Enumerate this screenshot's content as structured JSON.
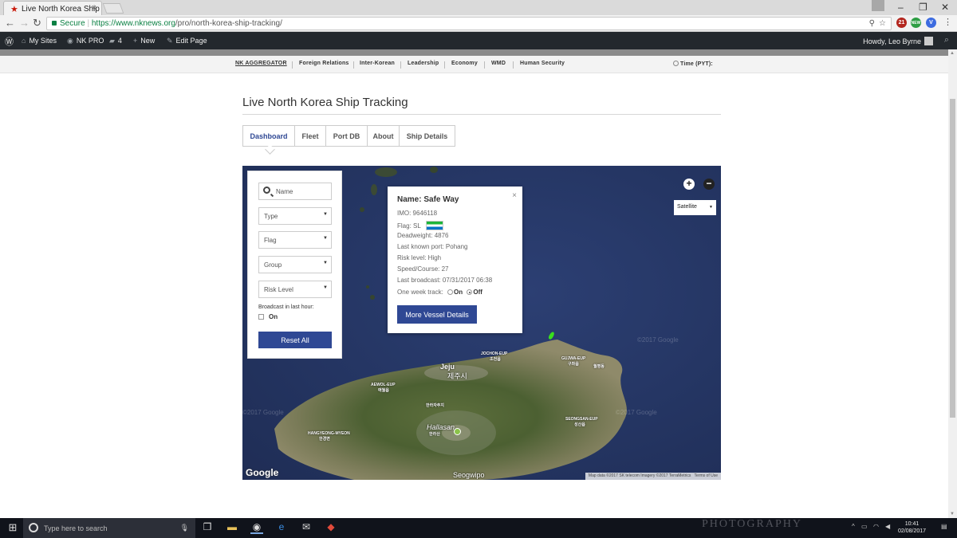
{
  "browser": {
    "tab_title": "Live North Korea Ship Tracking",
    "tab_close": "×",
    "secure_label": "Secure",
    "url_host": "https://www.nknews.org",
    "url_path": "/pro/north-korea-ship-tracking/",
    "ext_badge_new": "NEW",
    "ext_badge_count": "21"
  },
  "adminbar": {
    "my_sites": "My Sites",
    "nk_pro": "NK PRO",
    "comments_count": "4",
    "new": "New",
    "edit_page": "Edit Page",
    "greeting": "Howdy, Leo Byrne"
  },
  "sitenav": {
    "items": [
      "NK AGGREGATOR",
      "Foreign Relations",
      "Inter-Korean",
      "Leadership",
      "Economy",
      "WMD",
      "Human Security"
    ],
    "time_label": "Time (PYT):"
  },
  "page": {
    "title": "Live North Korea Ship Tracking",
    "tabs": [
      "Dashboard",
      "Fleet",
      "Port DB",
      "About",
      "Ship Details"
    ]
  },
  "filters": {
    "name_placeholder": "Name",
    "type": "Type",
    "flag": "Flag",
    "group": "Group",
    "risk_level": "Risk Level",
    "broadcast_label": "Broadcast in last hour:",
    "broadcast_on": "On",
    "reset": "Reset All"
  },
  "vessel_popup": {
    "name": "Name: Safe Way",
    "imo": "IMO: 9646118",
    "flag": "Flag: SL",
    "deadweight": "Deadweight: 4876",
    "last_port": "Last known port: Pohang",
    "risk": "Risk level: High",
    "speed": "Speed/Course: 27",
    "last_broadcast": "Last broadcast: 07/31/2017 06:38",
    "track_label": "One week track:",
    "track_on": "On",
    "track_off": "Off",
    "button": "More Vessel Details",
    "close": "×"
  },
  "map": {
    "map_type": "Satellite",
    "zoom_in": "+",
    "zoom_out": "−",
    "google": "Google",
    "attribution": "Map data ©2017 SK telecom Imagery ©2017 TerraMetrics",
    "terms": "Terms of Use",
    "watermark": "©2017 Google",
    "labels": {
      "jeju_en": "Jeju",
      "jeju_ko": "제주시",
      "jocheon": "JOCHON-EUP",
      "jocheon_ko": "조천읍",
      "gujwa": "GUJWA-EUP",
      "gujwa_ko": "구좌읍",
      "aewol": "AEWOL-EUP",
      "aewol_ko": "애월읍",
      "hallasan": "Hallasan",
      "hallasan_ko": "한라산",
      "hangyeong": "HANGYEONG-MYEON",
      "hangyeong_ko": "한경면",
      "seongsan": "SEONGSAN-EUP",
      "seongsan_ko": "성산읍",
      "seogwipo": "Seogwipo",
      "halla_park": "한라자추지",
      "wolpyeong": "월평동"
    }
  },
  "taskbar": {
    "search": "Type here to search",
    "time": "10:41",
    "date": "02/08/2017",
    "watermark": "PHOTOGRAPHY"
  },
  "colors": {
    "brand_blue": "#2f4894",
    "admin_bar": "#23282d",
    "ship": "#39e01c"
  }
}
